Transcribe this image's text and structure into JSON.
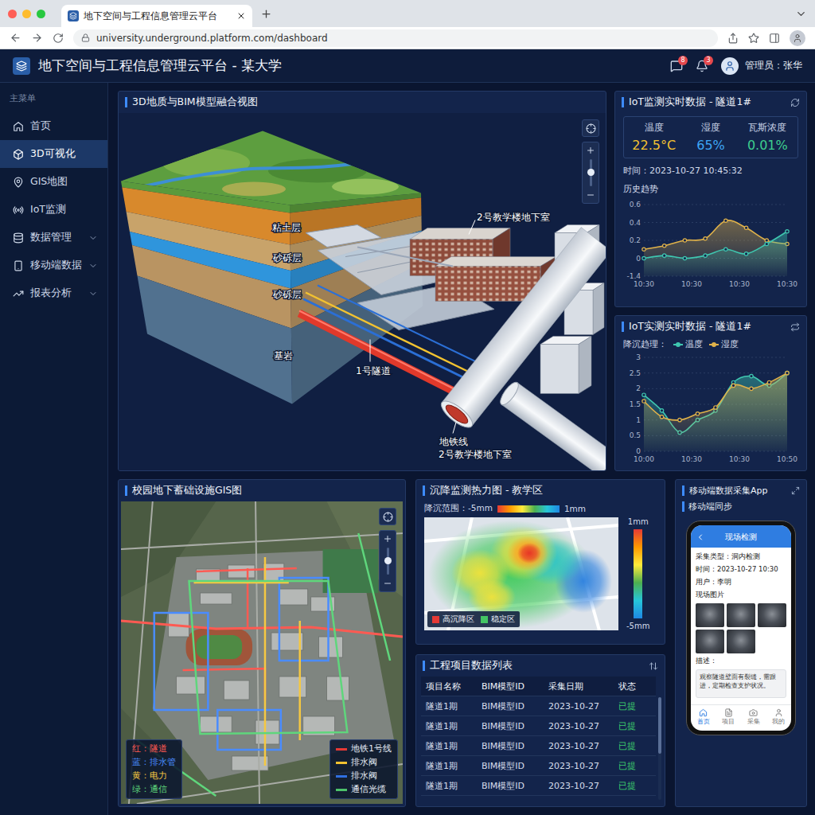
{
  "browser": {
    "tab_title": "地下空间与工程信息管理云平台",
    "url": "university.underground.platform.com/dashboard"
  },
  "header": {
    "title": "地下空间与工程信息管理云平台 - 某大学",
    "message_badge": "8",
    "bell_badge": "3",
    "user": "管理员：张华"
  },
  "sidebar": {
    "heading": "主菜单",
    "items": [
      {
        "label": "首页",
        "selected": false,
        "expandable": false
      },
      {
        "label": "3D可视化",
        "selected": true,
        "expandable": false
      },
      {
        "label": "GIS地图",
        "selected": false,
        "expandable": false
      },
      {
        "label": "IoT监测",
        "selected": false,
        "expandable": false
      },
      {
        "label": "数据管理",
        "selected": false,
        "expandable": true
      },
      {
        "label": "移动端数据",
        "selected": false,
        "expandable": true
      },
      {
        "label": "报表分析",
        "selected": false,
        "expandable": true
      }
    ]
  },
  "scene": {
    "title": "3D地质与BIM模型融合视图",
    "layers": [
      "粘土层",
      "砂砾层",
      "砂砾层",
      "基岩"
    ],
    "building_label": "2号教学楼地下室",
    "tunnel_label": "1号隧道",
    "subway_label": "地铁线",
    "subway_sub_label": "2号教学楼地下室"
  },
  "iot_live": {
    "title": "IoT监测实时数据 - 隧道1#",
    "metrics": [
      {
        "label": "温度",
        "value": "22.5°C",
        "color": "#f2c230"
      },
      {
        "label": "湿度",
        "value": "65%",
        "color": "#3ea6f5"
      },
      {
        "label": "瓦斯浓度",
        "value": "0.01%",
        "color": "#3ecf8e"
      }
    ],
    "time": "时间：2023-10-27 10:45:32",
    "chart_title": "历史趋势",
    "chart": {
      "y_ticks": [
        "0.6",
        "0.4",
        "0.2",
        "0",
        "-1.4"
      ],
      "x_ticks": [
        "10:30",
        "10:30",
        "10:30",
        "10:30"
      ],
      "series": [
        {
          "color": "#e0b24a",
          "values": [
            0.1,
            0.14,
            0.2,
            0.22,
            0.42,
            0.34,
            0.2,
            0.16
          ]
        },
        {
          "color": "#3fc7b0",
          "values": [
            0.0,
            0.03,
            0.0,
            0.03,
            0.1,
            0.05,
            0.16,
            0.3
          ]
        }
      ]
    }
  },
  "iot_trend": {
    "title": "IoT实测实时数据 - 隧道1#",
    "legend_title": "降沉趋理：",
    "chart": {
      "y_ticks": [
        "3",
        "2.5",
        "2",
        "1.5",
        "1",
        "0.5",
        "0"
      ],
      "x_ticks": [
        "10:00",
        "10:30",
        "10:30",
        "10:50"
      ],
      "series": [
        {
          "name": "温度",
          "color": "#3fc7b0",
          "values": [
            1.8,
            1.3,
            0.6,
            1.0,
            1.3,
            2.2,
            2.4,
            2.1,
            2.5
          ]
        },
        {
          "name": "湿度",
          "color": "#e0b24a",
          "values": [
            1.6,
            1.1,
            1.0,
            1.2,
            1.4,
            2.1,
            2.0,
            2.2,
            2.5
          ]
        }
      ]
    }
  },
  "gis": {
    "title": "校园地下蓄础设施GIS图",
    "legend": [
      {
        "label": "红：隧道",
        "color": "#ff5a52"
      },
      {
        "label": "蓝：排水管",
        "color": "#4a8cff"
      },
      {
        "label": "黄：电力",
        "color": "#f5c842"
      },
      {
        "label": "绿：通信",
        "color": "#5fd67c"
      }
    ],
    "lines": [
      {
        "label": "地铁1号线",
        "color": "#e53935"
      },
      {
        "label": "排水阀",
        "color": "#f2c230"
      },
      {
        "label": "排水阀",
        "color": "#2f6fe0"
      },
      {
        "label": "通信光缆",
        "color": "#4cc36a"
      }
    ]
  },
  "settlement": {
    "title": "沉降监测热力图 - 教学区",
    "range_label": "降沉范围：-5mm",
    "range_max": "1mm",
    "scale_top": "1mm",
    "scale_bottom": "-5mm",
    "legend": [
      {
        "label": "高沉降区",
        "color": "#e53935"
      },
      {
        "label": "稳定区",
        "color": "#43c463"
      }
    ]
  },
  "projects": {
    "title": "工程项目数据列表",
    "columns": [
      "项目名称",
      "BIM模型ID",
      "采集日期",
      "状态"
    ],
    "rows": [
      [
        "隧道1期",
        "BIM模型ID",
        "2023-10-27",
        "已提"
      ],
      [
        "隧道1期",
        "BIM模型ID",
        "2023-10-27",
        "已提"
      ],
      [
        "隧道1期",
        "BIM模型ID",
        "2023-10-27",
        "已提"
      ],
      [
        "隧道1期",
        "BIM模型ID",
        "2023-10-27",
        "已提"
      ],
      [
        "隧道1期",
        "BIM模型ID",
        "2023-10-27",
        "已提"
      ]
    ]
  },
  "mobile": {
    "title": "移动端数据采集App",
    "sync_label": "移动端同步",
    "app_title": "现场检测",
    "fields": [
      "采集类型：洞内检测",
      "时间：2023-10-27 10:30",
      "用户：李明"
    ],
    "photos_label": "现场图片",
    "photos": 5,
    "desc_label": "描述：",
    "desc": "观察隧道壁面有裂缝，需跟进，定期检查支护状况。",
    "nav": [
      {
        "label": "首页",
        "selected": true
      },
      {
        "label": "项目",
        "selected": false
      },
      {
        "label": "采集",
        "selected": false
      },
      {
        "label": "我的",
        "selected": false
      }
    ]
  }
}
